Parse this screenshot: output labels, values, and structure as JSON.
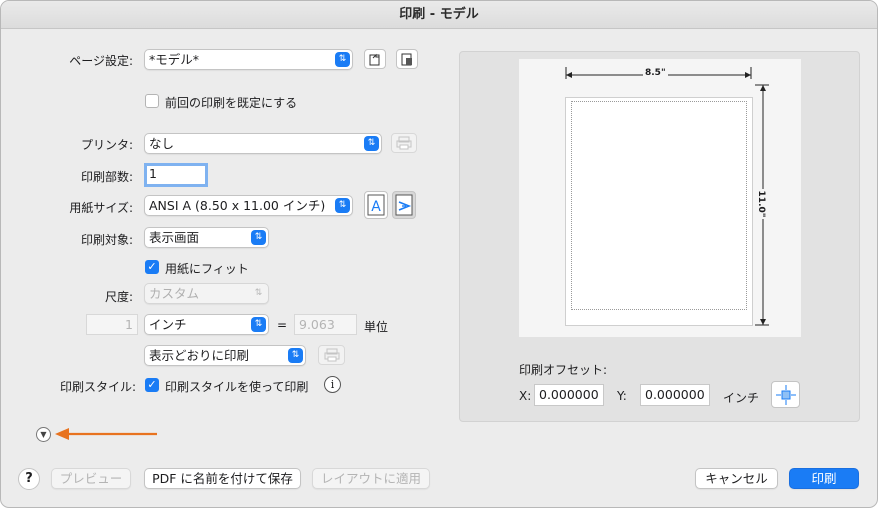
{
  "window": {
    "title": "印刷 - モデル"
  },
  "page_setup": {
    "label": "ページ設定:",
    "value": "*モデル*"
  },
  "default_checkbox": {
    "label": "前回の印刷を既定にする",
    "checked": false
  },
  "printer": {
    "label": "プリンタ:",
    "value": "なし"
  },
  "copies": {
    "label": "印刷部数:",
    "value": "1"
  },
  "paper_size": {
    "label": "用紙サイズ:",
    "value": "ANSI A (8.50 x 11.00 インチ)"
  },
  "print_target": {
    "label": "印刷対象:",
    "value": "表示画面"
  },
  "fit_checkbox": {
    "label": "用紙にフィット",
    "checked": true
  },
  "scale": {
    "label": "尺度:",
    "value": "カスタム"
  },
  "units": {
    "count": "1",
    "unit": "インチ",
    "equals": "=",
    "result": "9.063",
    "unit_label": "単位"
  },
  "print_as": {
    "value": "表示どおりに印刷"
  },
  "print_style": {
    "label": "印刷スタイル:",
    "checkbox_label": "印刷スタイルを使って印刷",
    "checked": true,
    "info": "i"
  },
  "preview": {
    "width_label": "8.5\"",
    "height_label": "11.0\"",
    "offset_title": "印刷オフセット:",
    "x_label": "X:",
    "x_value": "0.000000",
    "y_label": "Y:",
    "y_value": "0.000000",
    "unit": "インチ"
  },
  "footer": {
    "help": "?",
    "preview": "プレビュー",
    "save_pdf": "PDF に名前を付けて保存",
    "apply_layout": "レイアウトに適用",
    "cancel": "キャンセル",
    "print": "印刷"
  },
  "colors": {
    "accent": "#1a7cf5",
    "arrow": "#e8731f"
  }
}
